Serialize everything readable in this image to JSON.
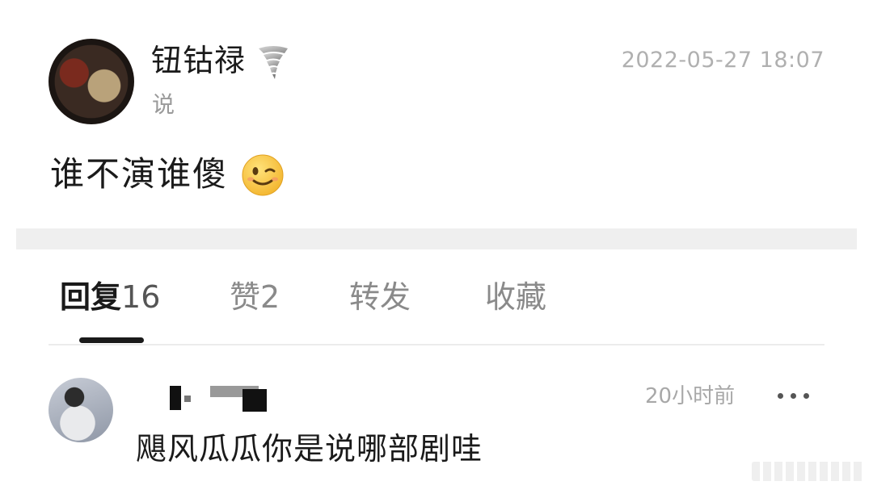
{
  "post": {
    "username": "钮钴禄",
    "action": "说",
    "timestamp": "2022-05-27 18:07",
    "body": "谁不演谁傻",
    "badge_icon": "tornado-icon",
    "emoji_icon": "winking-face-icon"
  },
  "tabs": [
    {
      "label": "回复",
      "count": "16",
      "active": true
    },
    {
      "label": "赞",
      "count": "2",
      "active": false
    },
    {
      "label": "转发",
      "count": "",
      "active": false
    },
    {
      "label": "收藏",
      "count": "",
      "active": false
    }
  ],
  "comment": {
    "time": "20小时前",
    "text": "飓风瓜瓜你是说哪部剧哇",
    "more_icon": "more-dots-icon"
  }
}
